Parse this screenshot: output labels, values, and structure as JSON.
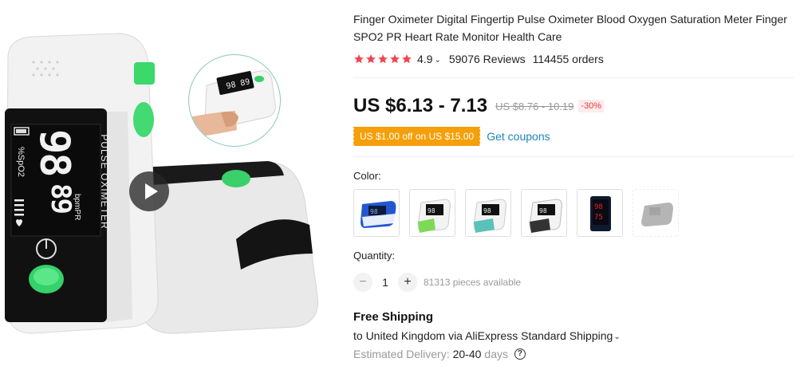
{
  "product": {
    "title": "Finger Oximeter Digital Fingertip Pulse Oximeter Blood Oxygen Saturation Meter Finger SPO2 PR Heart Rate Monitor Health Care",
    "rating": "4.9",
    "rating_stars": 5,
    "reviews": "59076 Reviews",
    "orders": "114455 orders"
  },
  "media": {
    "main_image": "oximeter-product-photo",
    "device_labels": {
      "brand_text": "PULSE OXIMETER",
      "spo2_reading": "98",
      "spo2_unit": "%SpO2",
      "pr_reading": "89",
      "pr_unit": "bpmPR"
    },
    "play_icon": "play-icon"
  },
  "price": {
    "current": "US $6.13 - 7.13",
    "original": "US $8.76 - 10.19",
    "discount": "-30%"
  },
  "coupon": {
    "tag": "US $1.00 off on US $15.00",
    "link": "Get coupons"
  },
  "color": {
    "label": "Color:",
    "options": [
      {
        "name": "blue",
        "accent": "#1f4fbf"
      },
      {
        "name": "green",
        "accent": "#7ed957"
      },
      {
        "name": "teal",
        "accent": "#5bc2b8"
      },
      {
        "name": "black-white",
        "accent": "#333333"
      },
      {
        "name": "red-display",
        "accent": "#c8161d"
      },
      {
        "name": "grey",
        "accent": "#7a7a7a"
      }
    ]
  },
  "quantity": {
    "label": "Quantity:",
    "value": "1",
    "available": "81313 pieces available",
    "minus": "−",
    "plus": "+"
  },
  "shipping": {
    "title": "Free Shipping",
    "destination": "to United Kingdom via AliExpress Standard Shipping",
    "delivery_label": "Estimated Delivery:",
    "delivery_value": "20-40",
    "delivery_unit": "days",
    "help": "?"
  },
  "colors": {
    "star": "#f1454f",
    "price": "#111111",
    "discount_text": "#e8363c",
    "coupon_bg": "#f59f0a",
    "link": "#1a86bb",
    "muted": "#999999"
  }
}
